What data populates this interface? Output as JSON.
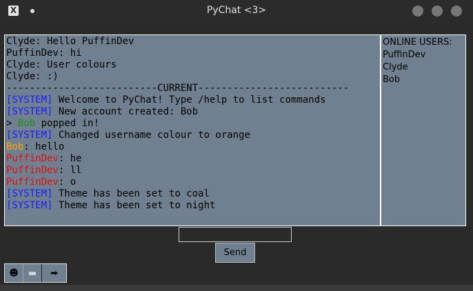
{
  "window": {
    "title": "PyChat <3>"
  },
  "chat": {
    "lines": [
      {
        "segments": [
          {
            "text": "Clyde: Hello PuffinDev",
            "color": "#000000"
          }
        ]
      },
      {
        "segments": [
          {
            "text": "PuffinDev: hi",
            "color": "#000000"
          }
        ]
      },
      {
        "segments": [
          {
            "text": "Clyde: User colours",
            "color": "#000000"
          }
        ]
      },
      {
        "segments": [
          {
            "text": "Clyde: :)",
            "color": "#000000"
          }
        ]
      },
      {
        "segments": [
          {
            "text": "--------------------------CURRENT--------------------------",
            "color": "#000000"
          }
        ]
      },
      {
        "segments": [
          {
            "text": "[SYSTEM]",
            "color": "#1a1aff"
          },
          {
            "text": " Welcome to PyChat! Type /help to list commands",
            "color": "#000000"
          }
        ]
      },
      {
        "segments": [
          {
            "text": "[SYSTEM]",
            "color": "#1a1aff"
          },
          {
            "text": " New account created: Bob",
            "color": "#000000"
          }
        ]
      },
      {
        "segments": [
          {
            "text": "> ",
            "color": "#000000"
          },
          {
            "text": "Bob",
            "color": "#1f8f1f"
          },
          {
            "text": " popped in!",
            "color": "#000000"
          }
        ]
      },
      {
        "segments": [
          {
            "text": "[SYSTEM]",
            "color": "#1a1aff"
          },
          {
            "text": " Changed username colour to orange",
            "color": "#000000"
          }
        ]
      },
      {
        "segments": [
          {
            "text": "Bob",
            "color": "#ffa500"
          },
          {
            "text": ": hello",
            "color": "#000000"
          }
        ]
      },
      {
        "segments": [
          {
            "text": "PuffinDev",
            "color": "#e01010"
          },
          {
            "text": ": he",
            "color": "#000000"
          }
        ]
      },
      {
        "segments": [
          {
            "text": "PuffinDev",
            "color": "#e01010"
          },
          {
            "text": ": ll",
            "color": "#000000"
          }
        ]
      },
      {
        "segments": [
          {
            "text": "PuffinDev",
            "color": "#e01010"
          },
          {
            "text": ": o",
            "color": "#000000"
          }
        ]
      },
      {
        "segments": [
          {
            "text": "[SYSTEM]",
            "color": "#1a1aff"
          },
          {
            "text": " Theme has been set to coal",
            "color": "#000000"
          }
        ]
      },
      {
        "segments": [
          {
            "text": "[SYSTEM]",
            "color": "#1a1aff"
          },
          {
            "text": " Theme has been set to night",
            "color": "#000000"
          }
        ]
      }
    ]
  },
  "users": {
    "header": "ONLINE USERS:",
    "items": [
      "PuffinDev",
      "Clyde",
      "Bob"
    ]
  },
  "input": {
    "value": ""
  },
  "send": {
    "label": "Send"
  },
  "toolbar": {
    "emoji_icon": "☻",
    "minimize_icon": "▬",
    "arrow_icon": "➡"
  },
  "colors": {
    "panel_bg": "#708090",
    "window_bg": "#2a2a2a",
    "system": "#1a1aff"
  }
}
